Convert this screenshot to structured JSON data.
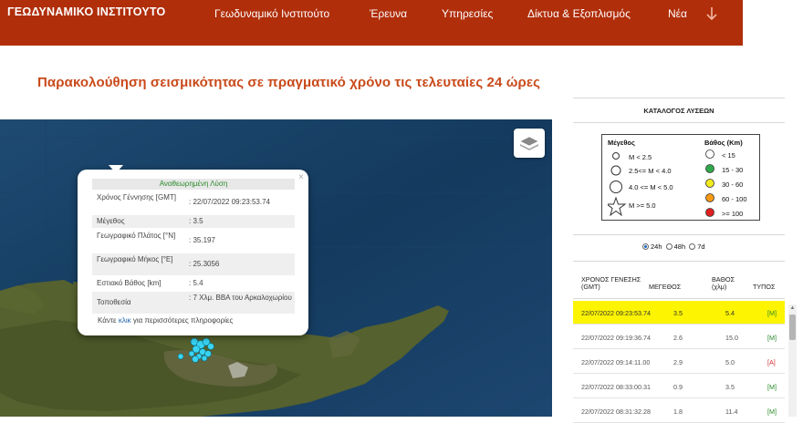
{
  "header": {
    "logo": "ΓΕΩΔΥΝΑΜΙΚΟ ΙΝΣΤΙΤΟΥΤΟ",
    "nav": [
      "Γεωδυναμικό Ινστιτούτο",
      "Έρευνα",
      "Υπηρεσίες",
      "Δίκτυα & Εξοπλισμός",
      "Νέα"
    ],
    "nav_arrow_icon": "arrow-down-icon"
  },
  "page_title": "Παρακολούθηση σεισμικότητας σε πραγματικό χρόνο τις τελευταίες 24 ώρες",
  "popup": {
    "title": "Αναθεωρημένη Λύση",
    "close": "×",
    "rows": [
      {
        "label": "Χρόνος Γέννησης [GMT]",
        "value": ": 22/07/2022 09:23:53.74"
      },
      {
        "label": "Μέγεθος",
        "value": ": 3.5"
      },
      {
        "label": "Γεωγραφικό Πλάτος [°N]",
        "value": ": 35.197"
      },
      {
        "label": "Γεωγραφικό Μήκος [°E]",
        "value": ": 25.3056"
      },
      {
        "label": "Εστιακό Βάθος [km]",
        "value": ": 5.4"
      },
      {
        "label": "Τοποθεσία",
        "value": ": 7 Χλμ. ΒΒΑ του Αρκαλοχωρίου"
      }
    ],
    "more_prefix": "Κάντε ",
    "more_link": "κλικ",
    "more_suffix": " για περισσότερες πληροφορίες"
  },
  "sidebar": {
    "catalog_title": "ΚΑΤΑΛΟΓΟΣ ΛΥΣΕΩΝ",
    "legend": {
      "magnitude_header": "Μέγεθος",
      "magnitude_items": [
        "M < 2.5",
        "2.5<= M < 4.0",
        "4.0 <= M < 5.0",
        "M >= 5.0"
      ],
      "depth_header": "Βάθος (Km)",
      "depth_items": [
        {
          "label": "< 15",
          "color": "#ffffff"
        },
        {
          "label": "15 - 30",
          "color": "#2eaa4a"
        },
        {
          "label": "30 - 60",
          "color": "#f2ea1c"
        },
        {
          "label": "60 - 100",
          "color": "#f59a12"
        },
        {
          "label": ">= 100",
          "color": "#e02020"
        }
      ]
    },
    "time_filters": [
      {
        "label": "24h",
        "selected": true
      },
      {
        "label": "48h",
        "selected": false
      },
      {
        "label": "7d",
        "selected": false
      }
    ],
    "table": {
      "headers": [
        "ΧΡΟΝΟΣ ΓΕΝΕΣΗΣ (GMT)",
        "ΜΕΓΕΘΟΣ",
        "ΒΑΘΟΣ (χλμ)",
        "ΤΥΠΟΣ"
      ],
      "rows": [
        {
          "time": "22/07/2022 09:23:53.74",
          "magnitude": "3.5",
          "depth": "5.4",
          "type": "[M]",
          "type_color": "#2a8a2a"
        },
        {
          "time": "22/07/2022 09:19:36.74",
          "magnitude": "2.6",
          "depth": "15.0",
          "type": "[M]",
          "type_color": "#2a8a2a"
        },
        {
          "time": "22/07/2022 09:14:11.00",
          "magnitude": "2.9",
          "depth": "5.0",
          "type": "[A]",
          "type_color": "#d03030"
        },
        {
          "time": "22/07/2022 08:33:00.31",
          "magnitude": "0.9",
          "depth": "3.5",
          "type": "[M]",
          "type_color": "#2a8a2a"
        },
        {
          "time": "22/07/2022 08:31:32.28",
          "magnitude": "1.8",
          "depth": "11.4",
          "type": "[M]",
          "type_color": "#2a8a2a"
        }
      ]
    }
  },
  "colors": {
    "header_bg": "#b02e0a",
    "title": "#c94a1a",
    "highlight_row": "#fcf400",
    "sea": "#143a5e"
  }
}
